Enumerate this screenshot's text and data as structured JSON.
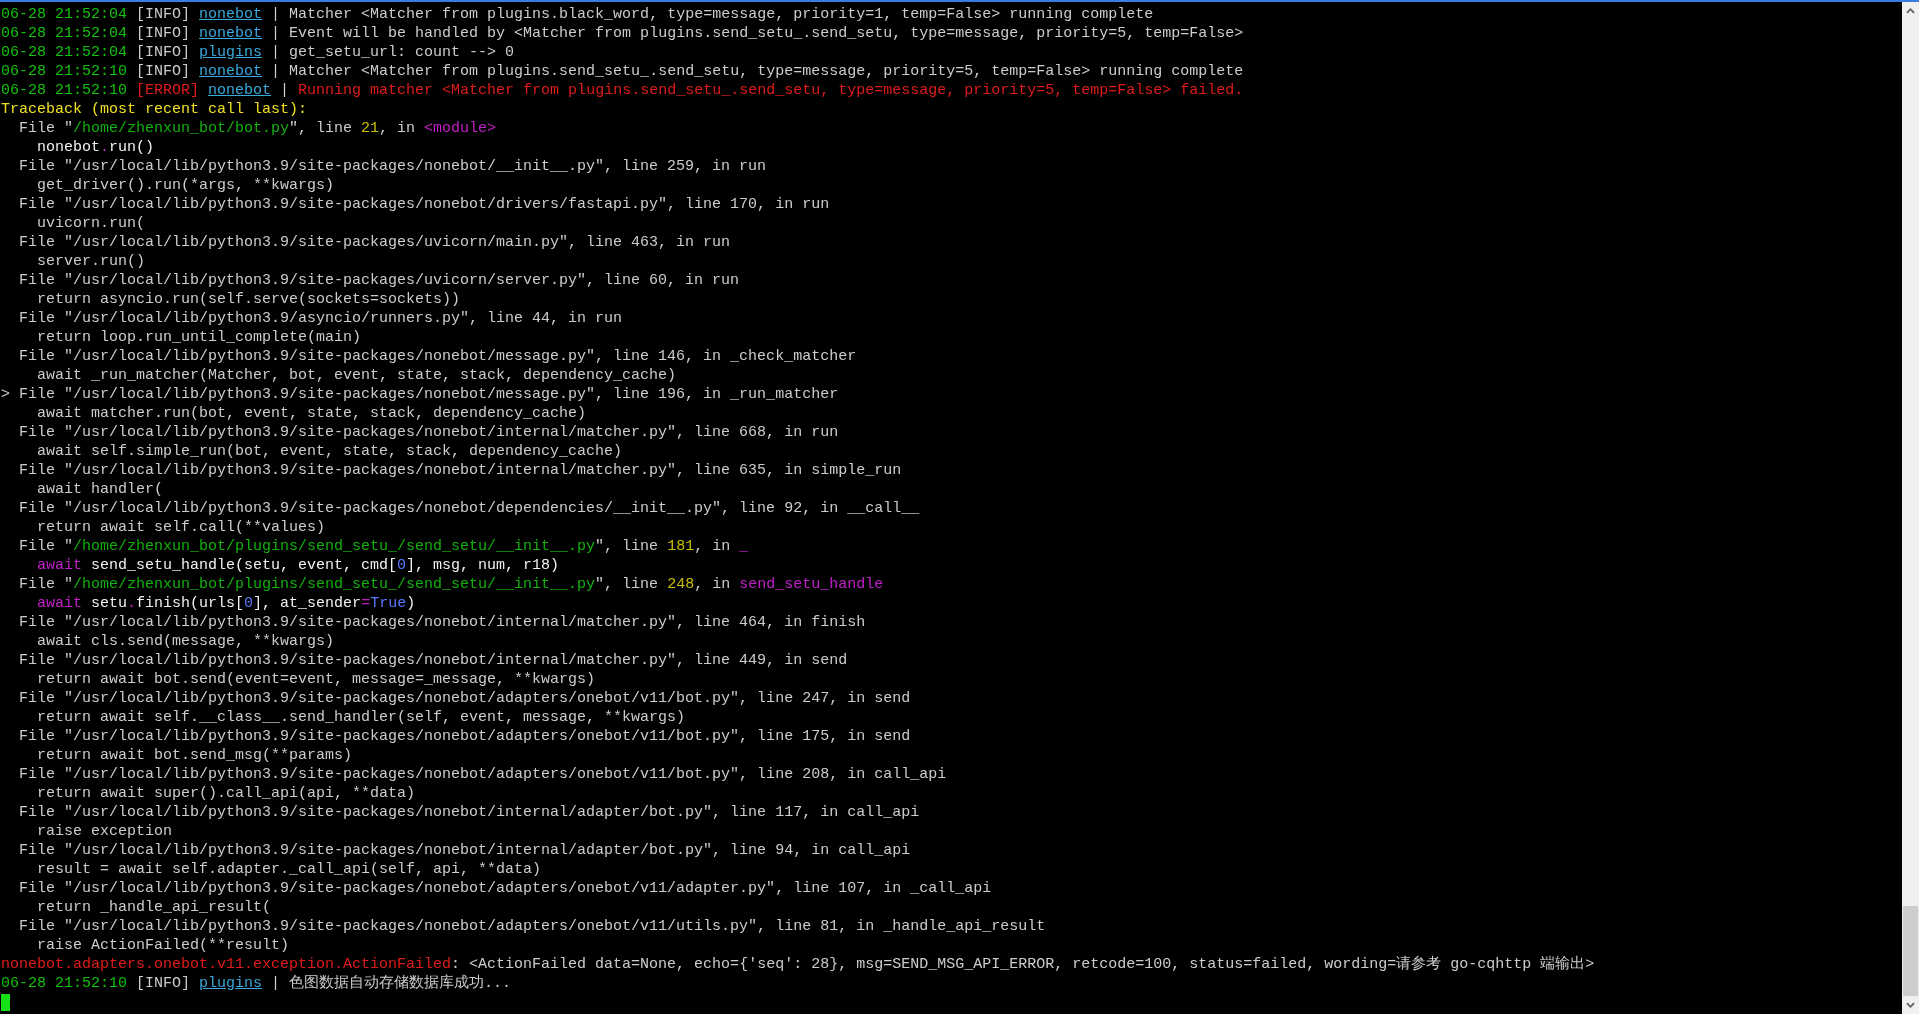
{
  "terminal": {
    "lines": [
      {
        "segments": [
          {
            "text": "06-28 21:52:04 ",
            "kind": "time"
          },
          {
            "text": "[INFO] ",
            "kind": "text"
          },
          {
            "text": "nonebot",
            "kind": "link"
          },
          {
            "text": " | Matcher <Matcher from plugins.black_word, type=message, priority=1, temp=False> running complete",
            "kind": "text"
          }
        ]
      },
      {
        "segments": [
          {
            "text": "06-28 21:52:04 ",
            "kind": "time"
          },
          {
            "text": "[INFO] ",
            "kind": "text"
          },
          {
            "text": "nonebot",
            "kind": "link"
          },
          {
            "text": " | Event will be handled by <Matcher from plugins.send_setu_.send_setu, type=message, priority=5, temp=False>",
            "kind": "text"
          }
        ]
      },
      {
        "segments": [
          {
            "text": "06-28 21:52:04 ",
            "kind": "time"
          },
          {
            "text": "[INFO] ",
            "kind": "text"
          },
          {
            "text": "plugins",
            "kind": "link"
          },
          {
            "text": " | get_setu_url: count --> 0",
            "kind": "text"
          }
        ]
      },
      {
        "segments": [
          {
            "text": "06-28 21:52:10 ",
            "kind": "time"
          },
          {
            "text": "[INFO] ",
            "kind": "text"
          },
          {
            "text": "nonebot",
            "kind": "link"
          },
          {
            "text": " | Matcher <Matcher from plugins.send_setu_.send_setu, type=message, priority=5, temp=False> running complete",
            "kind": "text"
          }
        ]
      },
      {
        "segments": [
          {
            "text": "06-28 21:52:10 ",
            "kind": "time"
          },
          {
            "text": "[ERROR] ",
            "kind": "error"
          },
          {
            "text": "nonebot",
            "kind": "link"
          },
          {
            "text": " | ",
            "kind": "text"
          },
          {
            "text": "Running matcher <Matcher from plugins.send_setu_.send_setu, type=message, priority=5, temp=False> failed.",
            "kind": "error"
          }
        ]
      },
      {
        "segments": [
          {
            "text": "Traceback (most recent call last):",
            "kind": "warn"
          }
        ]
      },
      {
        "segments": [
          {
            "text": "  File \"",
            "kind": "text"
          },
          {
            "text": "/home/zhenxun_bot/bot.py",
            "kind": "path"
          },
          {
            "text": "\", line ",
            "kind": "text"
          },
          {
            "text": "21",
            "kind": "number"
          },
          {
            "text": ", in ",
            "kind": "text"
          },
          {
            "text": "<module>",
            "kind": "magenta"
          }
        ]
      },
      {
        "segments": [
          {
            "text": "    nonebot",
            "kind": "bright"
          },
          {
            "text": ".",
            "kind": "magenta"
          },
          {
            "text": "run()",
            "kind": "bright"
          }
        ]
      },
      {
        "segments": [
          {
            "text": "  File \"/usr/local/lib/python3.9/site-packages/nonebot/__init__.py\", line 259, in run",
            "kind": "text"
          }
        ]
      },
      {
        "segments": [
          {
            "text": "    get_driver().run(*args, **kwargs)",
            "kind": "text"
          }
        ]
      },
      {
        "segments": [
          {
            "text": "  File \"/usr/local/lib/python3.9/site-packages/nonebot/drivers/fastapi.py\", line 170, in run",
            "kind": "text"
          }
        ]
      },
      {
        "segments": [
          {
            "text": "    uvicorn.run(",
            "kind": "text"
          }
        ]
      },
      {
        "segments": [
          {
            "text": "  File \"/usr/local/lib/python3.9/site-packages/uvicorn/main.py\", line 463, in run",
            "kind": "text"
          }
        ]
      },
      {
        "segments": [
          {
            "text": "    server.run()",
            "kind": "text"
          }
        ]
      },
      {
        "segments": [
          {
            "text": "  File \"/usr/local/lib/python3.9/site-packages/uvicorn/server.py\", line 60, in run",
            "kind": "text"
          }
        ]
      },
      {
        "segments": [
          {
            "text": "    return asyncio.run(self.serve(sockets=sockets))",
            "kind": "text"
          }
        ]
      },
      {
        "segments": [
          {
            "text": "  File \"/usr/local/lib/python3.9/asyncio/runners.py\", line 44, in run",
            "kind": "text"
          }
        ]
      },
      {
        "segments": [
          {
            "text": "    return loop.run_until_complete(main)",
            "kind": "text"
          }
        ]
      },
      {
        "segments": [
          {
            "text": "  File \"/usr/local/lib/python3.9/site-packages/nonebot/message.py\", line 146, in _check_matcher",
            "kind": "text"
          }
        ]
      },
      {
        "segments": [
          {
            "text": "    await _run_matcher(Matcher, bot, event, state, stack, dependency_cache)",
            "kind": "text"
          }
        ]
      },
      {
        "segments": [
          {
            "text": "> File \"/usr/local/lib/python3.9/site-packages/nonebot/message.py\", line 196, in _run_matcher",
            "kind": "text"
          }
        ]
      },
      {
        "segments": [
          {
            "text": "    await matcher.run(bot, event, state, stack, dependency_cache)",
            "kind": "text"
          }
        ]
      },
      {
        "segments": [
          {
            "text": "  File \"/usr/local/lib/python3.9/site-packages/nonebot/internal/matcher.py\", line 668, in run",
            "kind": "text"
          }
        ]
      },
      {
        "segments": [
          {
            "text": "    await self.simple_run(bot, event, state, stack, dependency_cache)",
            "kind": "text"
          }
        ]
      },
      {
        "segments": [
          {
            "text": "  File \"/usr/local/lib/python3.9/site-packages/nonebot/internal/matcher.py\", line 635, in simple_run",
            "kind": "text"
          }
        ]
      },
      {
        "segments": [
          {
            "text": "    await handler(",
            "kind": "text"
          }
        ]
      },
      {
        "segments": [
          {
            "text": "  File \"/usr/local/lib/python3.9/site-packages/nonebot/dependencies/__init__.py\", line 92, in __call__",
            "kind": "text"
          }
        ]
      },
      {
        "segments": [
          {
            "text": "    return await self.call(**values)",
            "kind": "text"
          }
        ]
      },
      {
        "segments": [
          {
            "text": "  File \"",
            "kind": "text"
          },
          {
            "text": "/home/zhenxun_bot/plugins/send_setu_/send_setu/__init__.py",
            "kind": "path"
          },
          {
            "text": "\", line ",
            "kind": "text"
          },
          {
            "text": "181",
            "kind": "number"
          },
          {
            "text": ", in ",
            "kind": "text"
          },
          {
            "text": "_",
            "kind": "magenta"
          }
        ]
      },
      {
        "segments": [
          {
            "text": "    await",
            "kind": "magenta"
          },
          {
            "text": " send_setu_handle(setu, event, cmd[",
            "kind": "bright"
          },
          {
            "text": "0",
            "kind": "blue"
          },
          {
            "text": "], msg, num, r18)",
            "kind": "bright"
          }
        ]
      },
      {
        "segments": [
          {
            "text": "  File \"",
            "kind": "text"
          },
          {
            "text": "/home/zhenxun_bot/plugins/send_setu_/send_setu/__init__.py",
            "kind": "path"
          },
          {
            "text": "\", line ",
            "kind": "text"
          },
          {
            "text": "248",
            "kind": "number"
          },
          {
            "text": ", in ",
            "kind": "text"
          },
          {
            "text": "send_setu_handle",
            "kind": "magenta"
          }
        ]
      },
      {
        "segments": [
          {
            "text": "    await",
            "kind": "magenta"
          },
          {
            "text": " setu",
            "kind": "bright"
          },
          {
            "text": ".",
            "kind": "magenta"
          },
          {
            "text": "finish(urls[",
            "kind": "bright"
          },
          {
            "text": "0",
            "kind": "blue"
          },
          {
            "text": "], at_sender",
            "kind": "bright"
          },
          {
            "text": "=",
            "kind": "magenta"
          },
          {
            "text": "True",
            "kind": "blue"
          },
          {
            "text": ")",
            "kind": "bright"
          }
        ]
      },
      {
        "segments": [
          {
            "text": "  File \"/usr/local/lib/python3.9/site-packages/nonebot/internal/matcher.py\", line 464, in finish",
            "kind": "text"
          }
        ]
      },
      {
        "segments": [
          {
            "text": "    await cls.send(message, **kwargs)",
            "kind": "text"
          }
        ]
      },
      {
        "segments": [
          {
            "text": "  File \"/usr/local/lib/python3.9/site-packages/nonebot/internal/matcher.py\", line 449, in send",
            "kind": "text"
          }
        ]
      },
      {
        "segments": [
          {
            "text": "    return await bot.send(event=event, message=_message, **kwargs)",
            "kind": "text"
          }
        ]
      },
      {
        "segments": [
          {
            "text": "  File \"/usr/local/lib/python3.9/site-packages/nonebot/adapters/onebot/v11/bot.py\", line 247, in send",
            "kind": "text"
          }
        ]
      },
      {
        "segments": [
          {
            "text": "    return await self.__class__.send_handler(self, event, message, **kwargs)",
            "kind": "text"
          }
        ]
      },
      {
        "segments": [
          {
            "text": "  File \"/usr/local/lib/python3.9/site-packages/nonebot/adapters/onebot/v11/bot.py\", line 175, in send",
            "kind": "text"
          }
        ]
      },
      {
        "segments": [
          {
            "text": "    return await bot.send_msg(**params)",
            "kind": "text"
          }
        ]
      },
      {
        "segments": [
          {
            "text": "  File \"/usr/local/lib/python3.9/site-packages/nonebot/adapters/onebot/v11/bot.py\", line 208, in call_api",
            "kind": "text"
          }
        ]
      },
      {
        "segments": [
          {
            "text": "    return await super().call_api(api, **data)",
            "kind": "text"
          }
        ]
      },
      {
        "segments": [
          {
            "text": "  File \"/usr/local/lib/python3.9/site-packages/nonebot/internal/adapter/bot.py\", line 117, in call_api",
            "kind": "text"
          }
        ]
      },
      {
        "segments": [
          {
            "text": "    raise exception",
            "kind": "text"
          }
        ]
      },
      {
        "segments": [
          {
            "text": "  File \"/usr/local/lib/python3.9/site-packages/nonebot/internal/adapter/bot.py\", line 94, in call_api",
            "kind": "text"
          }
        ]
      },
      {
        "segments": [
          {
            "text": "    result = await self.adapter._call_api(self, api, **data)",
            "kind": "text"
          }
        ]
      },
      {
        "segments": [
          {
            "text": "  File \"/usr/local/lib/python3.9/site-packages/nonebot/adapters/onebot/v11/adapter.py\", line 107, in _call_api",
            "kind": "text"
          }
        ]
      },
      {
        "segments": [
          {
            "text": "    return _handle_api_result(",
            "kind": "text"
          }
        ]
      },
      {
        "segments": [
          {
            "text": "  File \"/usr/local/lib/python3.9/site-packages/nonebot/adapters/onebot/v11/utils.py\", line 81, in _handle_api_result",
            "kind": "text"
          }
        ]
      },
      {
        "segments": [
          {
            "text": "    raise ActionFailed(**result)",
            "kind": "text"
          }
        ]
      },
      {
        "segments": [
          {
            "text": "nonebot.adapters.onebot.v11.exception.ActionFailed",
            "kind": "error"
          },
          {
            "text": ": <ActionFailed data=None, echo={'seq': 28}, msg=SEND_MSG_API_ERROR, retcode=100, status=failed, wording=请参考 go-cqhttp 端输出>",
            "kind": "text"
          }
        ]
      },
      {
        "segments": [
          {
            "text": "06-28 21:52:10 ",
            "kind": "time"
          },
          {
            "text": "[INFO] ",
            "kind": "text"
          },
          {
            "text": "plugins",
            "kind": "link"
          },
          {
            "text": " | 色图数据自动存储数据库成功...",
            "kind": "text"
          }
        ]
      }
    ]
  }
}
